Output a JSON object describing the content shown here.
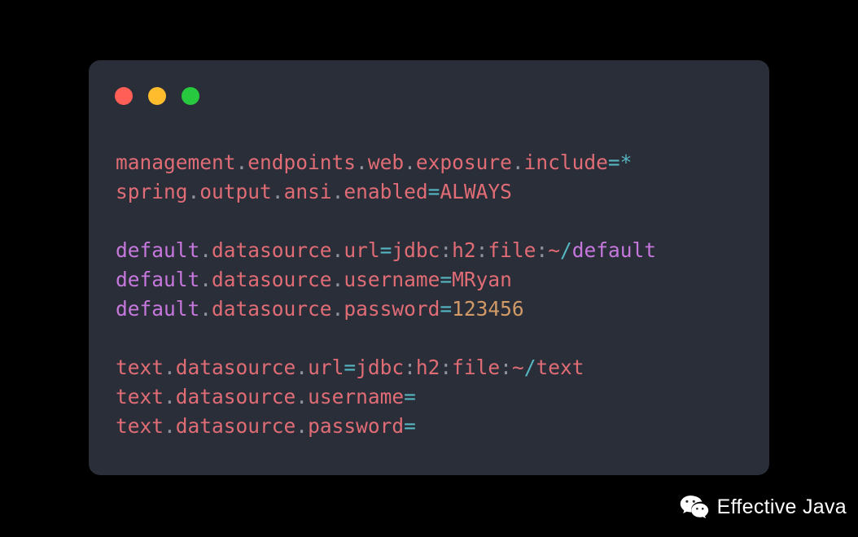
{
  "window": {
    "controls": [
      {
        "name": "close",
        "color": "#FF5F56"
      },
      {
        "name": "minimize",
        "color": "#FFBD2E"
      },
      {
        "name": "zoom",
        "color": "#27C93F"
      }
    ],
    "background": "#2A2E39",
    "page_background": "#000000"
  },
  "theme": {
    "key": "#E06C75",
    "namespace": "#C678DD",
    "separator": "#8B93A1",
    "operator": "#56B6C2",
    "number": "#D19A66",
    "path": "#56B6C2"
  },
  "code": {
    "language": "properties",
    "lines": [
      {
        "id": "line-1",
        "text": "management.endpoints.web.exposure.include=*",
        "tokens": [
          {
            "t": "management",
            "c": "key"
          },
          {
            "t": ".",
            "c": "sep"
          },
          {
            "t": "endpoints",
            "c": "key"
          },
          {
            "t": ".",
            "c": "sep"
          },
          {
            "t": "web",
            "c": "key"
          },
          {
            "t": ".",
            "c": "sep"
          },
          {
            "t": "exposure",
            "c": "key"
          },
          {
            "t": ".",
            "c": "sep"
          },
          {
            "t": "include",
            "c": "key"
          },
          {
            "t": "=",
            "c": "op"
          },
          {
            "t": "*",
            "c": "op"
          }
        ]
      },
      {
        "id": "line-2",
        "text": "spring.output.ansi.enabled=ALWAYS",
        "tokens": [
          {
            "t": "spring",
            "c": "key"
          },
          {
            "t": ".",
            "c": "sep"
          },
          {
            "t": "output",
            "c": "key"
          },
          {
            "t": ".",
            "c": "sep"
          },
          {
            "t": "ansi",
            "c": "key"
          },
          {
            "t": ".",
            "c": "sep"
          },
          {
            "t": "enabled",
            "c": "key"
          },
          {
            "t": "=",
            "c": "op"
          },
          {
            "t": "ALWAYS",
            "c": "value"
          }
        ]
      },
      {
        "id": "line-3",
        "text": "",
        "tokens": []
      },
      {
        "id": "line-4",
        "text": "default.datasource.url=jdbc:h2:file:~/default",
        "tokens": [
          {
            "t": "default",
            "c": "ns"
          },
          {
            "t": ".",
            "c": "sep"
          },
          {
            "t": "datasource",
            "c": "key"
          },
          {
            "t": ".",
            "c": "sep"
          },
          {
            "t": "url",
            "c": "key"
          },
          {
            "t": "=",
            "c": "op"
          },
          {
            "t": "jdbc",
            "c": "value"
          },
          {
            "t": ":",
            "c": "sep"
          },
          {
            "t": "h2",
            "c": "value"
          },
          {
            "t": ":",
            "c": "sep"
          },
          {
            "t": "file",
            "c": "value"
          },
          {
            "t": ":",
            "c": "sep"
          },
          {
            "t": "~",
            "c": "tilde"
          },
          {
            "t": "/",
            "c": "path"
          },
          {
            "t": "default",
            "c": "pathname"
          }
        ]
      },
      {
        "id": "line-5",
        "text": "default.datasource.username=MRyan",
        "tokens": [
          {
            "t": "default",
            "c": "ns"
          },
          {
            "t": ".",
            "c": "sep"
          },
          {
            "t": "datasource",
            "c": "key"
          },
          {
            "t": ".",
            "c": "sep"
          },
          {
            "t": "username",
            "c": "key"
          },
          {
            "t": "=",
            "c": "op"
          },
          {
            "t": "MRyan",
            "c": "value"
          }
        ]
      },
      {
        "id": "line-6",
        "text": "default.datasource.password=123456",
        "tokens": [
          {
            "t": "default",
            "c": "ns"
          },
          {
            "t": ".",
            "c": "sep"
          },
          {
            "t": "datasource",
            "c": "key"
          },
          {
            "t": ".",
            "c": "sep"
          },
          {
            "t": "password",
            "c": "key"
          },
          {
            "t": "=",
            "c": "op"
          },
          {
            "t": "123456",
            "c": "number"
          }
        ]
      },
      {
        "id": "line-7",
        "text": "",
        "tokens": []
      },
      {
        "id": "line-8",
        "text": "text.datasource.url=jdbc:h2:file:~/text",
        "tokens": [
          {
            "t": "text",
            "c": "key"
          },
          {
            "t": ".",
            "c": "sep"
          },
          {
            "t": "datasource",
            "c": "key"
          },
          {
            "t": ".",
            "c": "sep"
          },
          {
            "t": "url",
            "c": "key"
          },
          {
            "t": "=",
            "c": "op"
          },
          {
            "t": "jdbc",
            "c": "value"
          },
          {
            "t": ":",
            "c": "sep"
          },
          {
            "t": "h2",
            "c": "value"
          },
          {
            "t": ":",
            "c": "sep"
          },
          {
            "t": "file",
            "c": "value"
          },
          {
            "t": ":",
            "c": "sep"
          },
          {
            "t": "~",
            "c": "tilde"
          },
          {
            "t": "/",
            "c": "path"
          },
          {
            "t": "text",
            "c": "value"
          }
        ]
      },
      {
        "id": "line-9",
        "text": "text.datasource.username=",
        "tokens": [
          {
            "t": "text",
            "c": "key"
          },
          {
            "t": ".",
            "c": "sep"
          },
          {
            "t": "datasource",
            "c": "key"
          },
          {
            "t": ".",
            "c": "sep"
          },
          {
            "t": "username",
            "c": "key"
          },
          {
            "t": "=",
            "c": "op"
          }
        ]
      },
      {
        "id": "line-10",
        "text": "text.datasource.password=",
        "tokens": [
          {
            "t": "text",
            "c": "key"
          },
          {
            "t": ".",
            "c": "sep"
          },
          {
            "t": "datasource",
            "c": "key"
          },
          {
            "t": ".",
            "c": "sep"
          },
          {
            "t": "password",
            "c": "key"
          },
          {
            "t": "=",
            "c": "op"
          }
        ]
      }
    ]
  },
  "footer": {
    "icon": "wechat-icon",
    "label": "Effective Java"
  }
}
